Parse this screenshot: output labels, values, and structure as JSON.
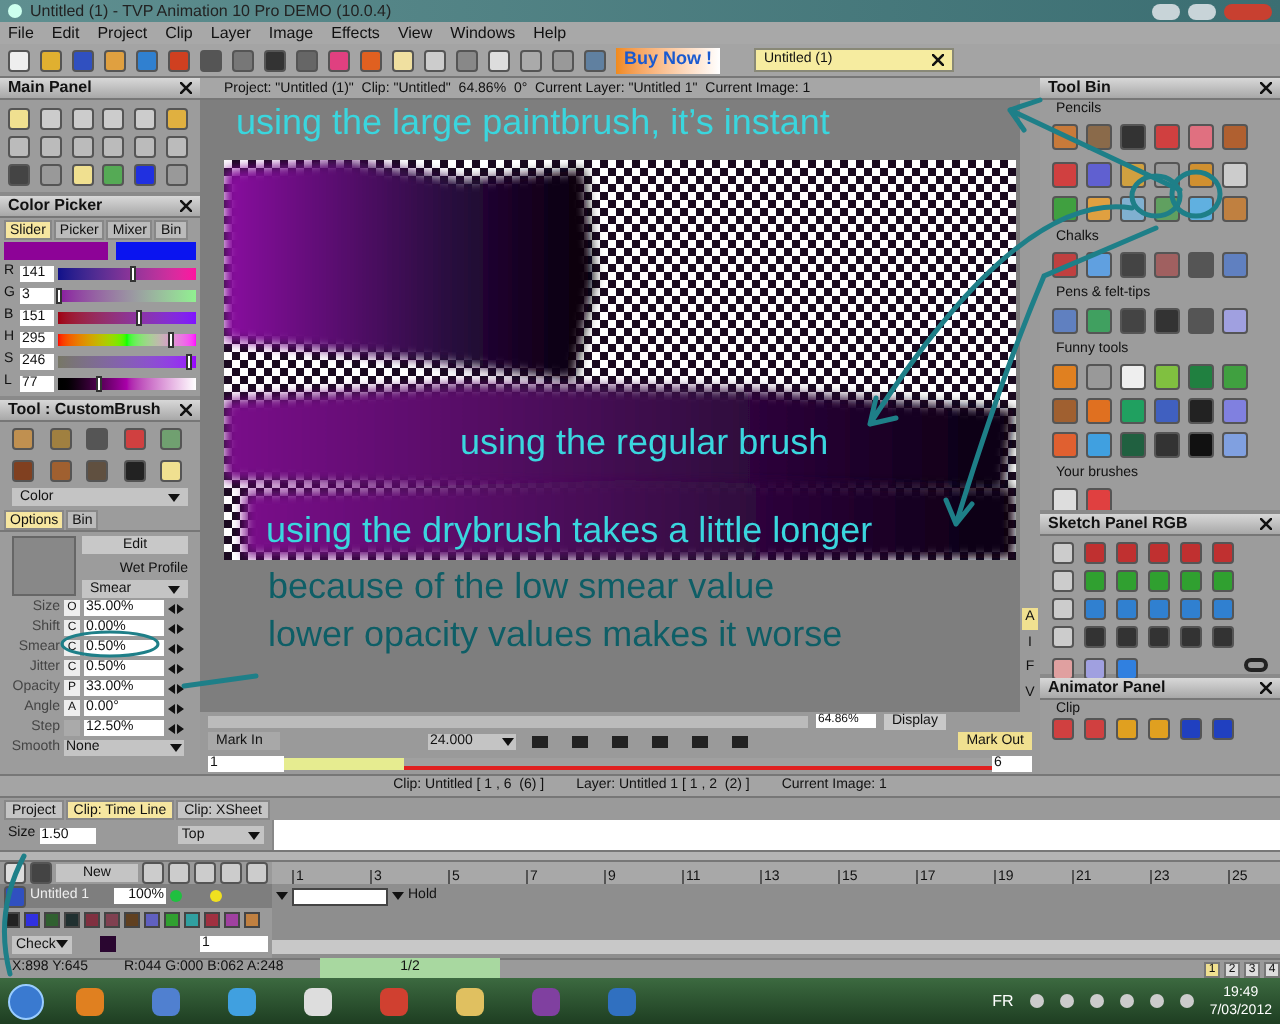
{
  "window": {
    "title": "Untitled (1) - TVP Animation 10 Pro DEMO (10.0.4)"
  },
  "menu": [
    "File",
    "Edit",
    "Project",
    "Clip",
    "Layer",
    "Image",
    "Effects",
    "View",
    "Windows",
    "Help"
  ],
  "toolbar": {
    "banner": "Buy Now !",
    "document_tab": "Untitled (1)"
  },
  "main_panel": {
    "title": "Main Panel"
  },
  "color_picker": {
    "title": "Color Picker",
    "tabs": [
      {
        "label": "Slider",
        "selected": true
      },
      {
        "label": "Picker",
        "selected": false
      },
      {
        "label": "Mixer",
        "selected": false
      },
      {
        "label": "Bin",
        "selected": false
      }
    ],
    "channels": [
      {
        "name": "R",
        "value": "141",
        "level": 0.55
      },
      {
        "name": "G",
        "value": "3",
        "level": 0.01
      },
      {
        "name": "B",
        "value": "151",
        "level": 0.59
      },
      {
        "name": "H",
        "value": "295",
        "level": 0.82
      },
      {
        "name": "S",
        "value": "246",
        "level": 0.96
      },
      {
        "name": "L",
        "value": "77",
        "level": 0.3
      }
    ]
  },
  "tool_panel": {
    "title": "Tool : CustomBrush",
    "mode": "Color",
    "tabs": [
      {
        "label": "Options",
        "selected": true
      },
      {
        "label": "Bin",
        "selected": false
      }
    ],
    "edit_button": "Edit",
    "wet_profile": "Wet Profile",
    "blend": "Smear",
    "params": [
      {
        "name": "Size",
        "mode": "O",
        "value": "35.00%"
      },
      {
        "name": "Shift",
        "mode": "C",
        "value": "0.00%"
      },
      {
        "name": "Smear",
        "mode": "C",
        "value": "0.50%"
      },
      {
        "name": "Jitter",
        "mode": "C",
        "value": "0.50%"
      },
      {
        "name": "Opacity",
        "mode": "P",
        "value": "33.00%"
      },
      {
        "name": "Angle",
        "mode": "A",
        "value": "0.00°"
      },
      {
        "name": "Step",
        "value": "12.50%"
      }
    ],
    "smooth": {
      "label": "Smooth",
      "value": "None"
    }
  },
  "viewer": {
    "info": "Project: \"Untitled (1)\"  Clip: \"Untitled\"  64.86%  0°  Current Layer: \"Untitled 1\"  Current Image: 1",
    "zoom": "64.86%",
    "display": "Display",
    "mark_in": "Mark In",
    "fps": "24.000",
    "mark_out": "Mark Out",
    "start_frame": "1",
    "end_frame": "6",
    "side_letters": [
      "A",
      "I",
      "F",
      "V"
    ]
  },
  "tool_bin": {
    "title": "Tool Bin",
    "sections": [
      "Pencils",
      "Chalks",
      "Pens & felt-tips",
      "Funny tools",
      "Your brushes"
    ]
  },
  "sketch_panel": {
    "title": "Sketch Panel RGB"
  },
  "animator_panel": {
    "title": "Animator Panel",
    "section": "Clip"
  },
  "status_line": {
    "clip": "Clip: Untitled [ 1 , 6  (6) ]",
    "layer": "Layer: Untitled 1 [ 1 , 2  (2) ]",
    "image": "Current Image: 1"
  },
  "bottom_tabs": [
    {
      "label": "Project",
      "selected": false
    },
    {
      "label": "Clip: Time Line",
      "selected": true
    },
    {
      "label": "Clip: XSheet",
      "selected": false
    }
  ],
  "timeline": {
    "size_label": "Size",
    "size": "1.50",
    "position": "Top",
    "new_button": "New",
    "layer": {
      "name": "Untitled 1",
      "opacity": "100%",
      "mode": "Hold"
    },
    "ruler": [
      "1",
      "3",
      "5",
      "7",
      "9",
      "11",
      "13",
      "15",
      "17",
      "19",
      "21",
      "23",
      "25"
    ],
    "check_mode": "Check",
    "frame": "1"
  },
  "status_bar": {
    "coords": "X:898 Y:645",
    "rgba": "R:044 G:000 B:062 A:248",
    "progress": "1/2",
    "pages": [
      {
        "label": "1",
        "selected": true
      },
      {
        "label": "2",
        "selected": false
      },
      {
        "label": "3",
        "selected": false
      },
      {
        "label": "4",
        "selected": false
      }
    ]
  },
  "taskbar": {
    "language": "FR",
    "time": "19:49",
    "date": "7/03/2012"
  },
  "annotations": [
    {
      "text": "using the large paintbrush, it’s instant",
      "color": "#3ad6de"
    },
    {
      "text": "using the regular brush",
      "color": "#3ad6de"
    },
    {
      "text": "using the drybrush takes a little longer",
      "color": "#3ad6de"
    },
    {
      "text": "because of the low smear value",
      "color": "#0e5e66"
    },
    {
      "text": "lower opacity values makes it worse",
      "color": "#0e5e66"
    }
  ]
}
